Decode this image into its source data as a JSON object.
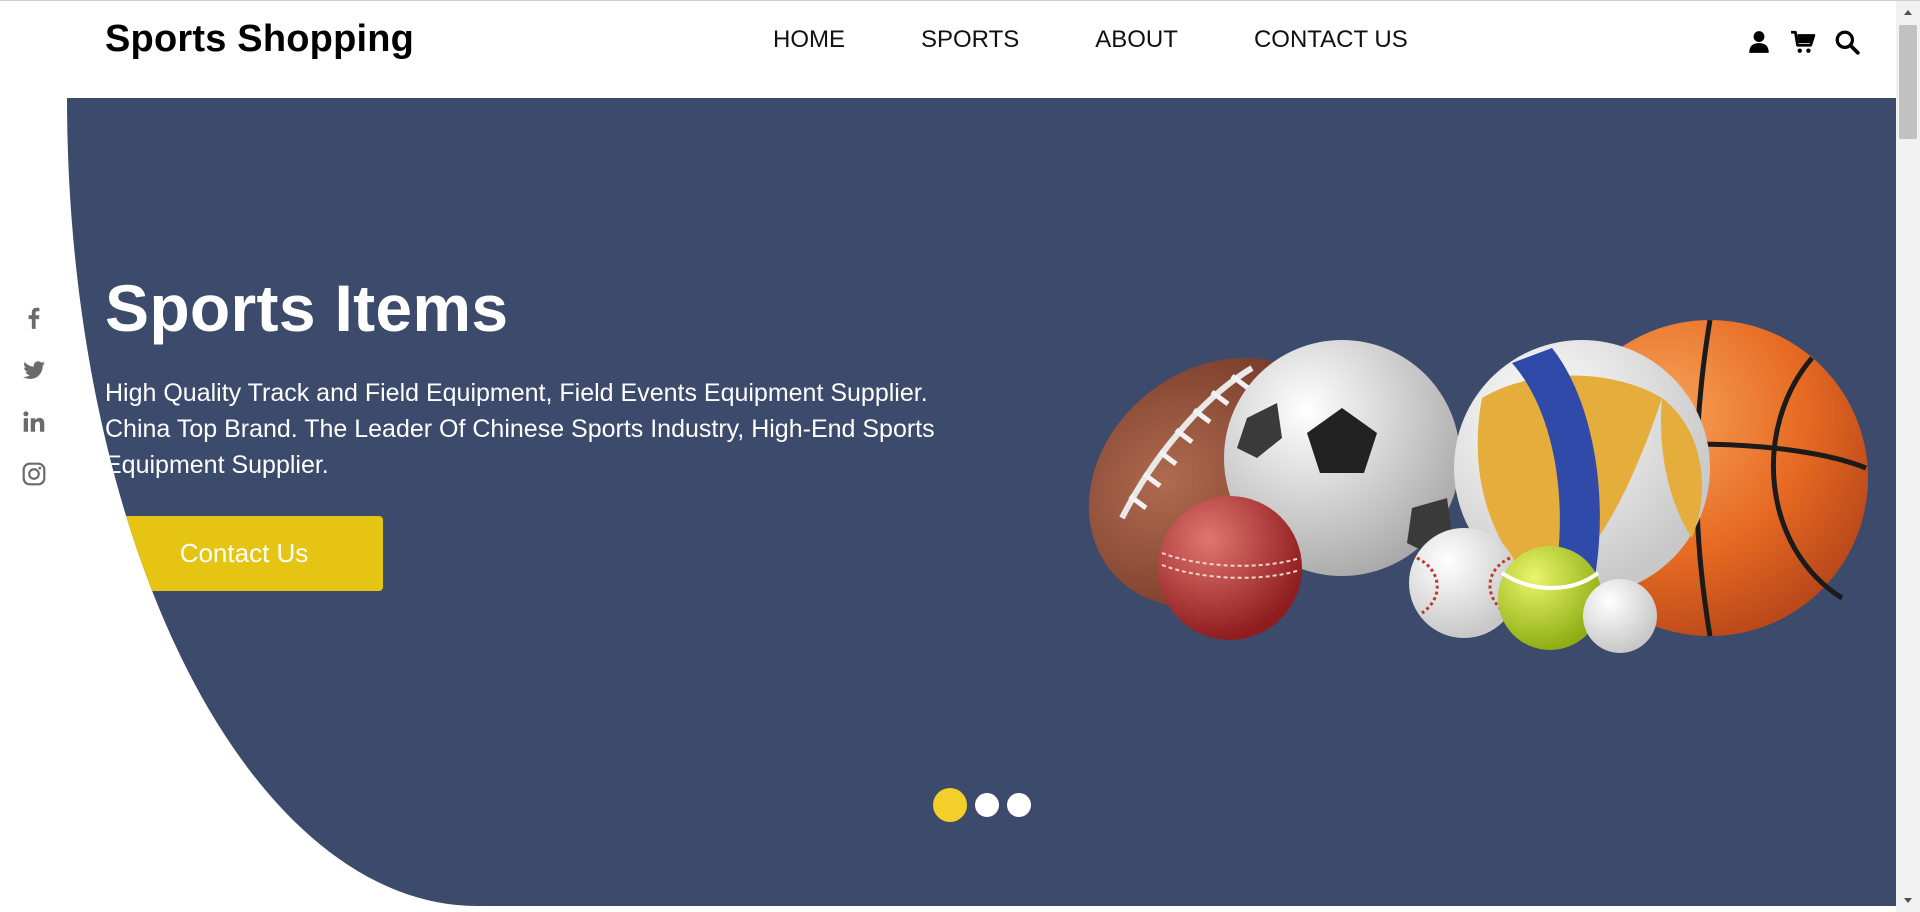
{
  "header": {
    "brand": "Sports Shopping",
    "nav": [
      "HOME",
      "SPORTS",
      "ABOUT",
      "CONTACT US"
    ],
    "icons": [
      "user-icon",
      "cart-icon",
      "search-icon"
    ]
  },
  "social": [
    "facebook-icon",
    "twitter-icon",
    "linkedin-icon",
    "instagram-icon"
  ],
  "hero": {
    "title": "Sports Items",
    "description": "High Quality Track and Field Equipment, Field Events Equipment Supplier. China Top Brand. The Leader Of Chinese Sports Industry, High-End Sports Equipment Supplier.",
    "button_label": "Contact Us",
    "background_color": "#3c4a6b",
    "button_color": "#e5c413",
    "image_subject": "sports balls",
    "slides": {
      "count": 3,
      "active": 1
    }
  }
}
